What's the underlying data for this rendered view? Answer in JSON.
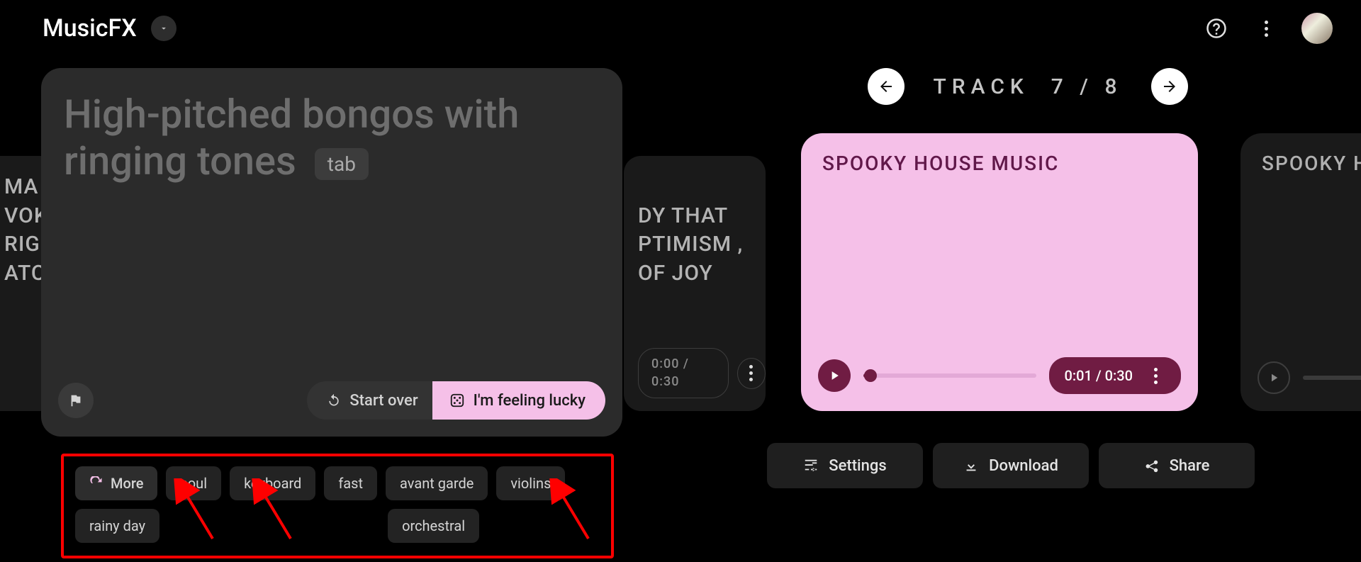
{
  "header": {
    "brand": "MusicFX"
  },
  "prompt": {
    "placeholder": "High-pitched bongos with ringing tones",
    "tab_hint": "tab",
    "start_over": "Start over",
    "feeling_lucky": "I'm feeling lucky"
  },
  "peek_left_text": "MA\nVOK\nRIGH\nATC",
  "peek_right_text": "DY THAT\nPTIMISM ,\nOF JOY",
  "peek_right_time": "0:00 / 0:30",
  "chips": {
    "more": "More",
    "items": [
      "soul",
      "keyboard",
      "fast",
      "avant garde",
      "violins",
      "rainy day",
      "orchestral"
    ]
  },
  "track_nav": {
    "label": "TRACK",
    "position": "7 / 8"
  },
  "cards": {
    "current": {
      "title": "SPOOKY HOUSE MUSIC",
      "time": "0:01 / 0:30",
      "progress_pct": 4
    },
    "next": {
      "title_visible": "SPOOKY HO"
    }
  },
  "actions": {
    "settings": "Settings",
    "download": "Download",
    "share": "Share"
  }
}
